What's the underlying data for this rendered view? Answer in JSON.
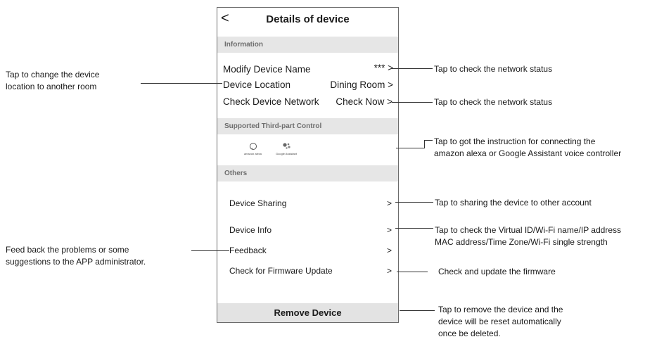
{
  "phone": {
    "back_label": "<",
    "title": "Details of device",
    "sections": {
      "information": "Information",
      "third_party": "Supported Third-part Control",
      "others": "Others"
    },
    "info_rows": [
      {
        "label": "Modify Device Name",
        "value": "*** >"
      },
      {
        "label": "Device Location",
        "value": "Dining Room >"
      },
      {
        "label": "Check Device Network",
        "value": "Check Now >"
      }
    ],
    "third_party_logos": [
      {
        "caption": "amazon alexa",
        "icon": "alexa-icon"
      },
      {
        "caption": "Google Assistant",
        "icon": "google-assistant-icon"
      }
    ],
    "other_rows": [
      {
        "label": "Device Sharing",
        "chevron": ">"
      },
      {
        "label": "Device Info",
        "chevron": ">"
      },
      {
        "label": "Feedback",
        "chevron": ">"
      },
      {
        "label": "Check for Firmware Update",
        "chevron": ">"
      }
    ],
    "remove_label": "Remove Device"
  },
  "annotations": {
    "left_location": [
      "Tap to change the device",
      "location to another room"
    ],
    "left_feedback": [
      "Feed back the problems or some",
      "suggestions to the APP administrator."
    ],
    "right_name": "Tap to check the network status",
    "right_network": "Tap to check the network status",
    "right_third_party": [
      "Tap to got the instruction for connecting the",
      "amazon alexa or Google Assistant voice controller"
    ],
    "right_sharing": "Tap to sharing the device to other account",
    "right_info": [
      "Tap to check the Virtual ID/Wi-Fi name/IP address",
      "MAC address/Time Zone/Wi-Fi single strength"
    ],
    "right_firmware": "Check and update the firmware",
    "right_remove": [
      "Tap to remove the device and the",
      "device will be reset automatically",
      "once be deleted."
    ]
  }
}
